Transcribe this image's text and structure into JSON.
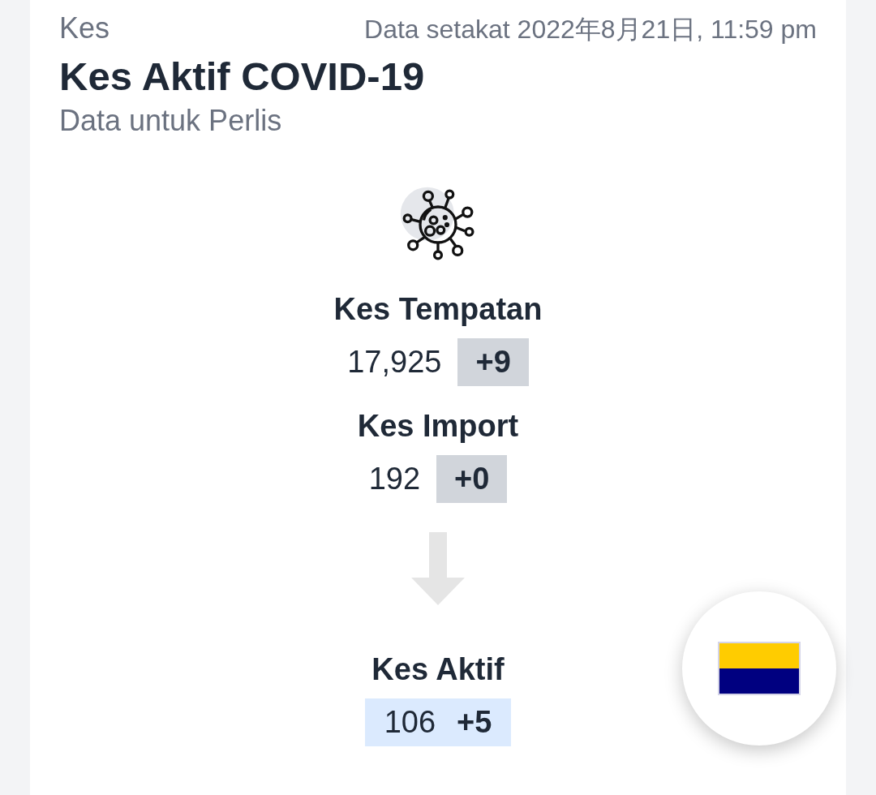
{
  "header": {
    "section": "Kes",
    "updated": "Data setakat 2022年8月21日, 11:59 pm",
    "title": "Kes Aktif COVID-19",
    "subtitle": "Data untuk Perlis"
  },
  "stats": [
    {
      "kind": "stat",
      "label": "Kes Tempatan",
      "value": "17,925",
      "delta": "+9"
    },
    {
      "kind": "stat",
      "label": "Kes Import",
      "value": "192",
      "delta": "+0"
    },
    {
      "kind": "arrow"
    },
    {
      "kind": "total",
      "label": "Kes Aktif",
      "value": "106",
      "delta": "+5"
    }
  ],
  "flag_button": {
    "stripes": [
      {
        "color": "#ffcc00"
      },
      {
        "color": "#000080"
      }
    ]
  }
}
